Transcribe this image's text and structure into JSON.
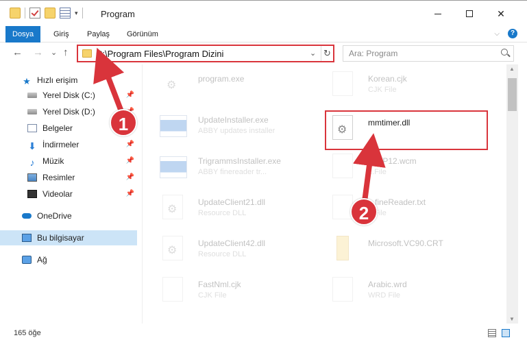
{
  "window": {
    "title": "Program",
    "qat_dropdown": "▾"
  },
  "window_controls": {
    "close": "✕"
  },
  "ribbon": {
    "tabs": [
      "Dosya",
      "Giriş",
      "Paylaş",
      "Görünüm"
    ],
    "expand": "⌵",
    "help": "?"
  },
  "nav": {
    "back": "←",
    "forward": "→",
    "history": "⌄",
    "up": "↑",
    "address": "C:\\Program Files\\Program Dizini",
    "address_dropdown": "⌄",
    "refresh": "↻",
    "search_placeholder": "Ara: Program"
  },
  "sidebar": {
    "items": [
      {
        "label": "Hızlı erişim",
        "icon": "star-icon"
      },
      {
        "label": "Yerel Disk (C:)",
        "icon": "disk-icon",
        "pinned": true
      },
      {
        "label": "Yerel Disk (D:)",
        "icon": "disk-icon",
        "pinned": true
      },
      {
        "label": "Belgeler",
        "icon": "documents-icon",
        "pinned": true
      },
      {
        "label": "İndirmeler",
        "icon": "download-icon",
        "pinned": true
      },
      {
        "label": "Müzik",
        "icon": "music-icon",
        "pinned": true
      },
      {
        "label": "Resimler",
        "icon": "pictures-icon",
        "pinned": true
      },
      {
        "label": "Videolar",
        "icon": "videos-icon",
        "pinned": true
      },
      {
        "label": "OneDrive",
        "icon": "cloud-icon"
      },
      {
        "label": "Bu bilgisayar",
        "icon": "computer-icon",
        "selected": true
      },
      {
        "label": "Ağ",
        "icon": "network-icon"
      }
    ],
    "pin_glyph": "📌",
    "star_glyph": "★",
    "down_glyph": "⬇",
    "music_glyph": "♪"
  },
  "files": [
    {
      "name": "program.exe",
      "type": "",
      "icon": "exe-icon",
      "dim": true
    },
    {
      "name": "Korean.cjk",
      "type": "CJK File",
      "icon": "file-icon",
      "dim": true
    },
    {
      "name": "UpdateInstaller.exe",
      "type": "ABBY updates installer",
      "icon": "installer-icon",
      "dim": true
    },
    {
      "name": "mmtimer.dll",
      "type": "",
      "icon": "dll-icon",
      "dim": false
    },
    {
      "name": "TrigrammsInstaller.exe",
      "type": "ABBY finereader tr...",
      "icon": "installer-icon",
      "dim": true
    },
    {
      "name": "...WP12.wcm",
      "type": "...File",
      "icon": "file-icon",
      "dim": true
    },
    {
      "name": "UpdateClient21.dll",
      "type": "Resource DLL",
      "icon": "dll-icon",
      "dim": true
    },
    {
      "name": "...fineReader.txt",
      "type": "...File",
      "icon": "file-icon",
      "dim": true
    },
    {
      "name": "UpdateClient42.dll",
      "type": "Resource DLL",
      "icon": "dll-icon",
      "dim": true
    },
    {
      "name": "Microsoft.VC90.CRT",
      "type": "",
      "icon": "folder-icon",
      "dim": true
    },
    {
      "name": "FastNml.cjk",
      "type": "CJK File",
      "icon": "file-icon",
      "dim": true
    },
    {
      "name": "Arabic.wrd",
      "type": "WRD File",
      "icon": "file-icon",
      "dim": true
    }
  ],
  "status": {
    "count": "165 öğe"
  },
  "annotations": [
    {
      "number": "1"
    },
    {
      "number": "2"
    }
  ],
  "colors": {
    "accent": "#1979ca",
    "highlight": "#d9343b"
  }
}
